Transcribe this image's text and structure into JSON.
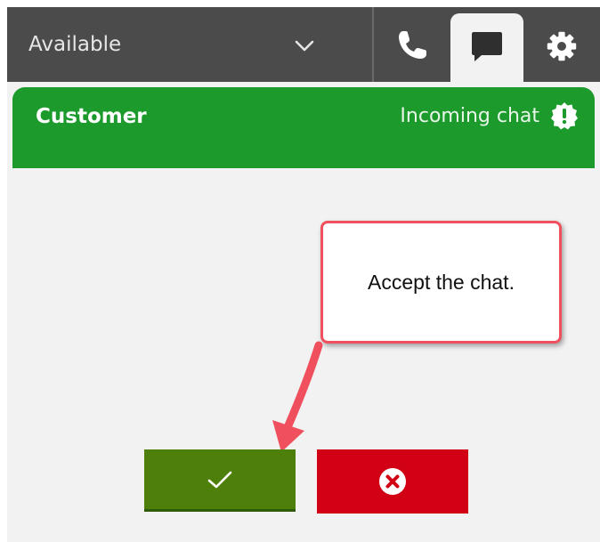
{
  "topbar": {
    "status_label": "Available",
    "status_icon": "chevron-down-icon",
    "tabs": [
      {
        "name": "phone",
        "icon": "phone-icon",
        "active": false
      },
      {
        "name": "chat",
        "icon": "chat-icon",
        "active": true
      },
      {
        "name": "settings",
        "icon": "gear-icon",
        "active": false
      }
    ]
  },
  "contact": {
    "name": "Customer",
    "state": "Incoming chat",
    "state_icon": "alert-icon",
    "color": "#1c9a2c"
  },
  "callout": {
    "text": "Accept the chat."
  },
  "actions": {
    "accept_icon": "checkmark-icon",
    "accept_color": "#4d7f0a",
    "reject_icon": "close-circle-icon",
    "reject_color": "#d10015"
  },
  "colors": {
    "topbar": "#4b4b4b",
    "background": "#f2f2f2",
    "callout_border": "#f0505e"
  }
}
